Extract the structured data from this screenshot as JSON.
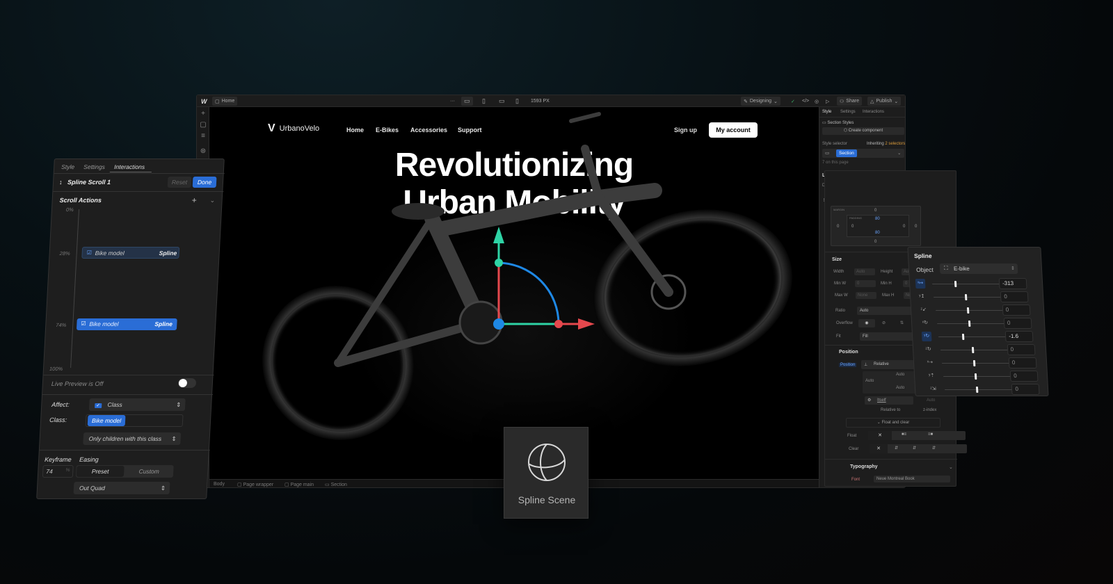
{
  "topbar": {
    "logo": "W",
    "page": "Home",
    "more": "···",
    "width": "1593 PX",
    "mode": "Designing",
    "share": "Share",
    "publish": "Publish"
  },
  "site": {
    "brand": "UrbanoVelo",
    "nav": [
      "Home",
      "E-Bikes",
      "Accessories",
      "Support"
    ],
    "signup": "Sign up",
    "account": "My account",
    "hero_line1": "Revolutionizing",
    "hero_line2": "Urban Mobility"
  },
  "breadcrumbs": [
    "Body",
    "Page wrapper",
    "Page main",
    "Section"
  ],
  "right_panel": {
    "tabs": [
      "Style",
      "Settings",
      "Interactions"
    ],
    "section_styles": "Section Styles",
    "create_component": "Create component",
    "style_selector": "Style selector",
    "inheriting": "Inheriting",
    "selectors_count": "2 selectors",
    "selector_tag": "Section",
    "on_page": "7 on this page",
    "layout": "Layout",
    "display": "Display",
    "spacing": "Spacing",
    "margin_label": "MARGIN",
    "padding_label": "PADDING",
    "margin": {
      "top": "0",
      "right": "0",
      "bottom": "0",
      "left": "0"
    },
    "padding": {
      "top": "80",
      "right": "0",
      "bottom": "80",
      "left": "0"
    },
    "size": "Size",
    "width_label": "Width",
    "width_val": "Auto",
    "height_label": "Height",
    "height_val": "Auto",
    "minw_label": "Min W",
    "minw_val": "0",
    "minw_unit": "PX",
    "minh_label": "Min H",
    "minh_val": "0",
    "maxw_label": "Max W",
    "maxw_val": "None",
    "maxh_label": "Max H",
    "maxh_val": "None",
    "ratio_label": "Ratio",
    "ratio_val": "Auto",
    "overflow_label": "Overflow",
    "fit_label": "Fit",
    "fit_val": "Fill",
    "position": "Position",
    "position_label": "Position",
    "position_val": "Relative",
    "pos_top": "Auto",
    "pos_left": "Auto",
    "pos_bottom": "Auto",
    "pos_right": "Auto",
    "relative_to_val": "Itself",
    "relative_to": "Relative to",
    "zindex_val": "Auto",
    "zindex": "z-index",
    "float_clear": "Float and clear",
    "float_label": "Float",
    "clear_label": "Clear",
    "typography": "Typography",
    "font_label": "Font",
    "font_val": "Neue Montreal Book"
  },
  "interactions_panel": {
    "tabs": [
      "Style",
      "Settings",
      "Interactions"
    ],
    "title": "Spline Scroll 1",
    "reset": "Reset",
    "done": "Done",
    "scroll_actions": "Scroll Actions",
    "ticks": [
      "0%",
      "28%",
      "74%",
      "100%"
    ],
    "actions": [
      {
        "position": "28%",
        "label": "Bike model",
        "type": "Spline",
        "selected": false
      },
      {
        "position": "74%",
        "label": "Bike model",
        "type": "Spline",
        "selected": true
      }
    ],
    "live_preview": "Live Preview is Off",
    "live_preview_on": false,
    "affect_label": "Affect:",
    "affect_val": "Class",
    "class_label": "Class:",
    "class_val": "Bike model",
    "children_val": "Only children with this class",
    "keyframe_label": "Keyframe",
    "easing_label": "Easing",
    "keyframe_val": "74",
    "keyframe_unit": "%",
    "preset": "Preset",
    "custom": "Custom",
    "easing_val": "Out Quad"
  },
  "spline_panel": {
    "title": "Spline",
    "object_label": "Object",
    "object_val": "E-bike",
    "rows": [
      {
        "icon": "position-x",
        "value": "-313",
        "level": 0.35,
        "active": true
      },
      {
        "icon": "position-y",
        "value": "0",
        "level": 0.5,
        "active": false
      },
      {
        "icon": "position-z",
        "value": "0",
        "level": 0.5,
        "active": false
      },
      {
        "icon": "rotation-x",
        "value": "0",
        "level": 0.5,
        "active": false
      },
      {
        "icon": "rotation-y",
        "value": "-1.6",
        "level": 0.38,
        "active": true
      },
      {
        "icon": "rotation-z",
        "value": "0",
        "level": 0.5,
        "active": false
      },
      {
        "icon": "scale-x",
        "value": "0",
        "level": 0.5,
        "active": false
      },
      {
        "icon": "scale-y",
        "value": "0",
        "level": 0.5,
        "active": false
      },
      {
        "icon": "scale-z",
        "value": "0",
        "level": 0.5,
        "active": false
      }
    ]
  },
  "card": {
    "label": "Spline Scene"
  },
  "colors": {
    "accent": "#2a6dd6",
    "gizmo_x": "#e5484d",
    "gizmo_y": "#2ed3a5",
    "gizmo_z": "#1e88e5",
    "inherit": "#d99a3a"
  }
}
